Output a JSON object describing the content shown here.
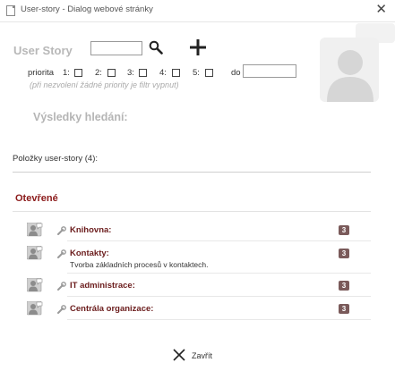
{
  "window": {
    "title": "User-story - Dialog webové stránky",
    "close_icon": "close-icon"
  },
  "search": {
    "label": "User Story",
    "value": "",
    "search_icon": "search-icon",
    "add_icon": "plus-icon"
  },
  "priority": {
    "label": "priorita",
    "options": [
      {
        "label": "1:",
        "checked": false
      },
      {
        "label": "2:",
        "checked": false
      },
      {
        "label": "3:",
        "checked": false
      },
      {
        "label": "4:",
        "checked": false
      },
      {
        "label": "5:",
        "checked": false
      }
    ],
    "to_label": "do",
    "to_value": "",
    "hint": "(při nezvolení žádné priority je filtr vypnut)"
  },
  "results": {
    "title": "Výsledky hledání:"
  },
  "items": {
    "count_label": "Položky user-story (4):",
    "section_title": "Otevřené",
    "stories": [
      {
        "name": "Knihovna:",
        "description": "",
        "badge": "3"
      },
      {
        "name": "Kontakty:",
        "description": "Tvorba základních procesů v kontaktech.",
        "badge": "3"
      },
      {
        "name": "IT administrace:",
        "description": "",
        "badge": "3"
      },
      {
        "name": "Centrála organizace:",
        "description": "",
        "badge": "3"
      }
    ]
  },
  "footer": {
    "close_label": "Zavřít",
    "close_icon": "x-icon"
  },
  "colors": {
    "section_title": "#8b1a1a",
    "story_name": "#6b1c1c",
    "badge": "#7a5a5a",
    "muted_heading": "#b8b8b8"
  }
}
